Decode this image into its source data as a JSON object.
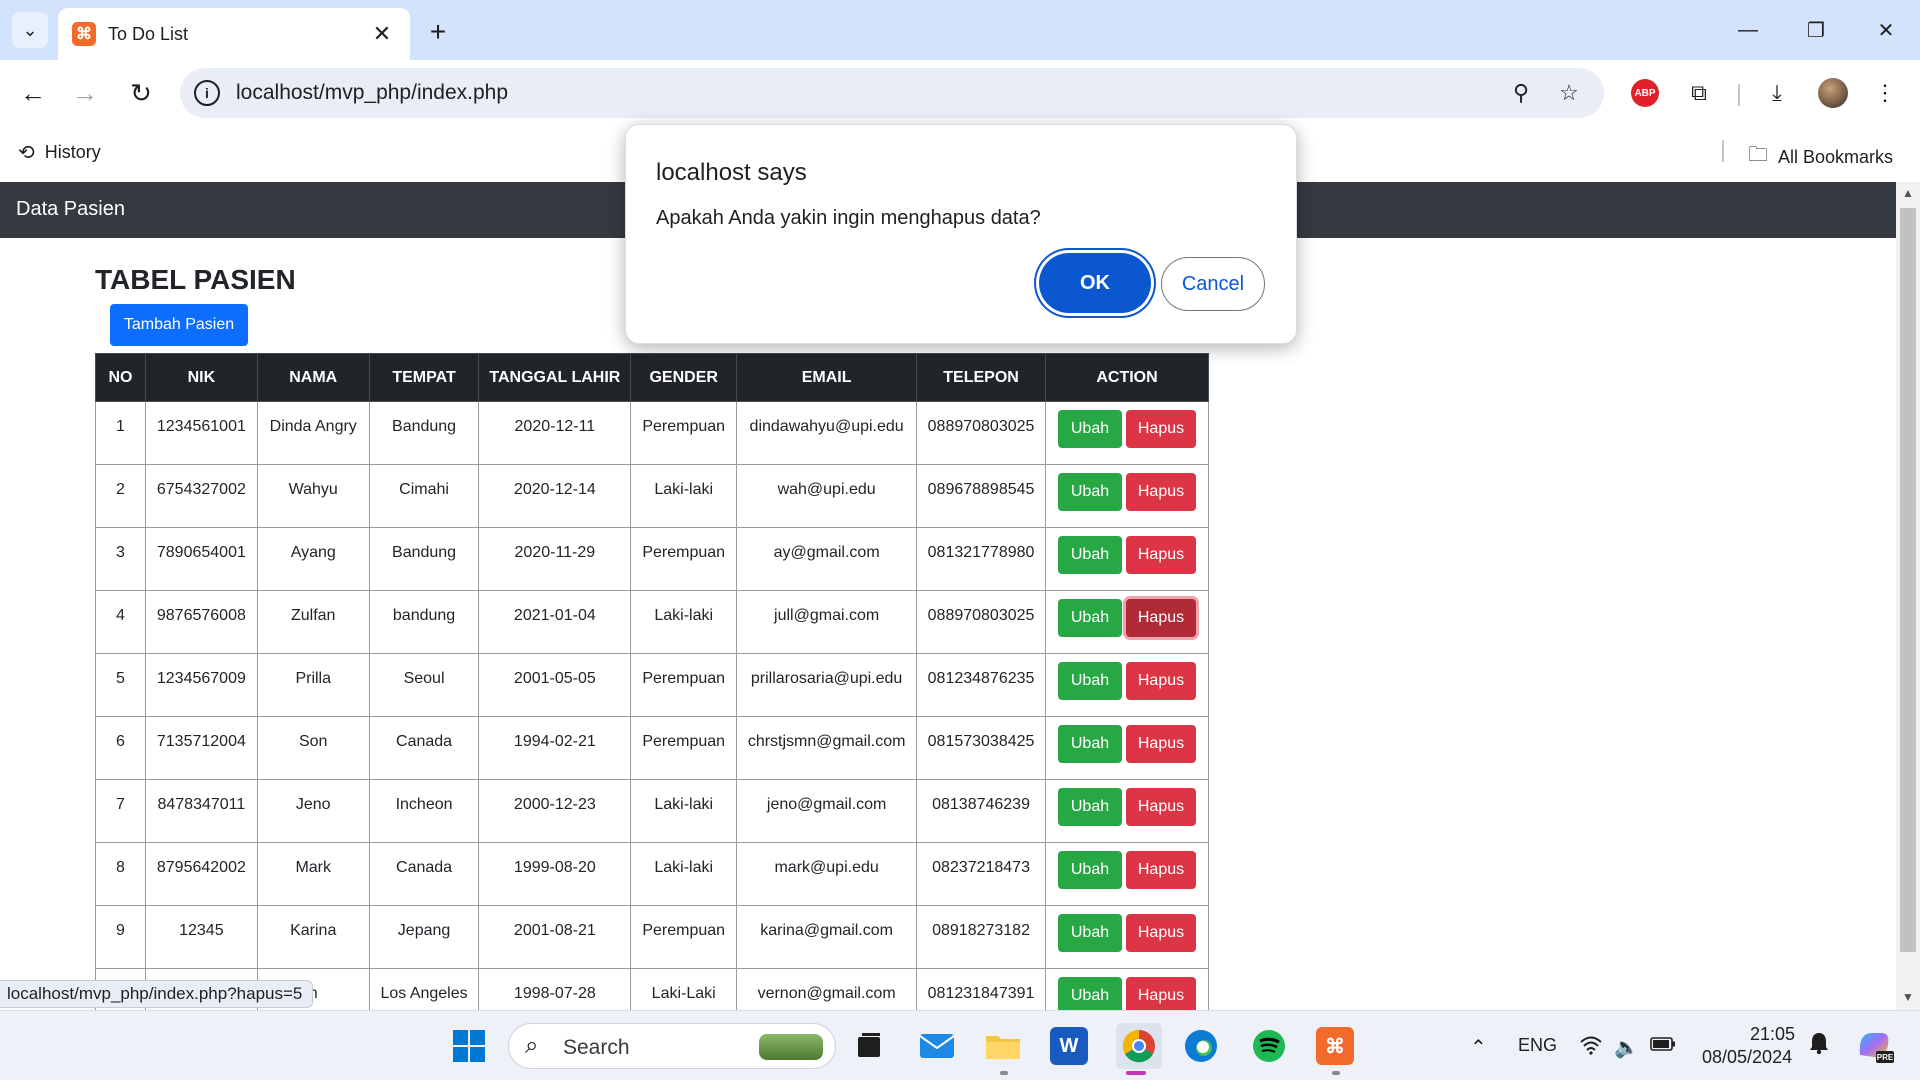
{
  "browser": {
    "tab_title": "To Do List",
    "url": "localhost/mvp_php/index.php",
    "bookmarks": {
      "history_label": "History",
      "all_bookmarks_label": "All Bookmarks"
    },
    "abp_label": "ABP",
    "status_url": "localhost/mvp_php/index.php?hapus=5"
  },
  "page": {
    "navbar_title": "Data Pasien",
    "heading": "TABEL PASIEN",
    "add_button": "Tambah Pasien",
    "table": {
      "headers": [
        "NO",
        "NIK",
        "NAMA",
        "TEMPAT",
        "TANGGAL LAHIR",
        "GENDER",
        "EMAIL",
        "TELEPON",
        "ACTION"
      ],
      "rows": [
        {
          "no": "1",
          "nik": "1234561001",
          "nama": "Dinda Angry",
          "tempat": "Bandung",
          "tgl": "2020-12-11",
          "gender": "Perempuan",
          "email": "dindawahyu@upi.edu",
          "telepon": "088970803025"
        },
        {
          "no": "2",
          "nik": "6754327002",
          "nama": "Wahyu",
          "tempat": "Cimahi",
          "tgl": "2020-12-14",
          "gender": "Laki-laki",
          "email": "wah@upi.edu",
          "telepon": "089678898545"
        },
        {
          "no": "3",
          "nik": "7890654001",
          "nama": "Ayang",
          "tempat": "Bandung",
          "tgl": "2020-11-29",
          "gender": "Perempuan",
          "email": "ay@gmail.com",
          "telepon": "081321778980"
        },
        {
          "no": "4",
          "nik": "9876576008",
          "nama": "Zulfan",
          "tempat": "bandung",
          "tgl": "2021-01-04",
          "gender": "Laki-laki",
          "email": "jull@gmai.com",
          "telepon": "088970803025"
        },
        {
          "no": "5",
          "nik": "1234567009",
          "nama": "Prilla",
          "tempat": "Seoul",
          "tgl": "2001-05-05",
          "gender": "Perempuan",
          "email": "prillarosaria@upi.edu",
          "telepon": "081234876235"
        },
        {
          "no": "6",
          "nik": "7135712004",
          "nama": "Son",
          "tempat": "Canada",
          "tgl": "1994-02-21",
          "gender": "Perempuan",
          "email": "chrstjsmn@gmail.com",
          "telepon": "081573038425"
        },
        {
          "no": "7",
          "nik": "8478347011",
          "nama": "Jeno",
          "tempat": "Incheon",
          "tgl": "2000-12-23",
          "gender": "Laki-laki",
          "email": "jeno@gmail.com",
          "telepon": "08138746239"
        },
        {
          "no": "8",
          "nik": "8795642002",
          "nama": "Mark",
          "tempat": "Canada",
          "tgl": "1999-08-20",
          "gender": "Laki-laki",
          "email": "mark@upi.edu",
          "telepon": "08237218473"
        },
        {
          "no": "9",
          "nik": "12345",
          "nama": "Karina",
          "tempat": "Jepang",
          "tgl": "2001-08-21",
          "gender": "Perempuan",
          "email": "karina@gmail.com",
          "telepon": "08918273182"
        },
        {
          "no": "",
          "nik": "",
          "nama": "n",
          "tempat": "Los Angeles",
          "tgl": "1998-07-28",
          "gender": "Laki-Laki",
          "email": "vernon@gmail.com",
          "telepon": "081231847391"
        }
      ],
      "edit_label": "Ubah",
      "delete_label": "Hapus"
    }
  },
  "dialog": {
    "title": "localhost says",
    "message": "Apakah Anda yakin ingin menghapus data?",
    "ok_label": "OK",
    "cancel_label": "Cancel"
  },
  "taskbar": {
    "search_placeholder": "Search",
    "language": "ENG",
    "time": "21:05",
    "date": "08/05/2024",
    "copilot_badge": "PRE",
    "word_label": "W"
  },
  "colors": {
    "navbar": "#343a40",
    "primary": "#0d6efd",
    "success": "#28a745",
    "danger": "#dc3545",
    "dialog_accent": "#0b57d0"
  }
}
